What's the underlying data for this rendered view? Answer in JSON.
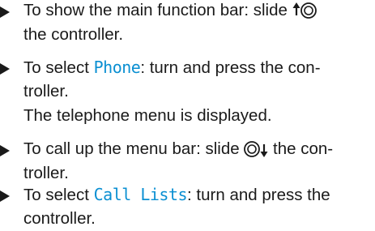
{
  "steps": [
    {
      "lines": [
        {
          "before": "To show the main function bar: slide ",
          "after": ""
        },
        {
          "text": "the controller."
        }
      ],
      "icon": "controller-slide-up-icon"
    },
    {
      "line1_before": "To select ",
      "ui": "Phone",
      "line1_after": ": turn and press the con-",
      "line2": "troller.",
      "result": "The telephone menu is displayed."
    },
    {
      "line1_before": "To call up the menu bar: slide ",
      "line1_after": " the con-",
      "line2": "troller.",
      "icon": "controller-slide-down-icon"
    },
    {
      "line1_before": "To select ",
      "ui": "Call Lists",
      "line1_after": ": turn and press the",
      "line2": "controller."
    }
  ]
}
